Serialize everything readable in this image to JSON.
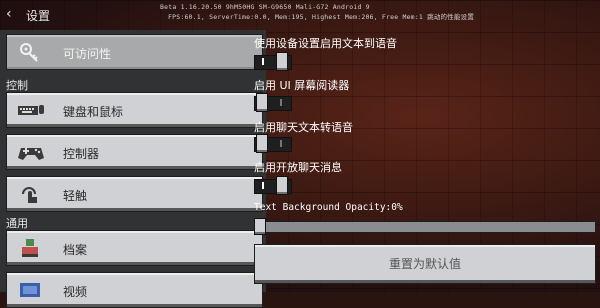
{
  "header": {
    "back_icon": "chevron-left-icon",
    "title": "设置",
    "debug_line1": "Beta 1.16.20.50 9hM50HG SM-G9650 Mali-G72 Android 9",
    "debug_line2": "FPS:60.1, ServerTime:0.0, Mem:195, Highest Mem:206, Free Mem:1 跳动的性能",
    "debug_line2_tail": "设置"
  },
  "sidebar": {
    "items": [
      {
        "label": "可访问性",
        "icon": "key-icon",
        "active": true
      },
      {
        "label": "键盘和鼠标",
        "icon": "keyboard-icon"
      },
      {
        "label": "控制器",
        "icon": "gamepad-icon"
      },
      {
        "label": "轻触",
        "icon": "touch-icon"
      },
      {
        "label": "档案",
        "icon": "profile-icon"
      },
      {
        "label": "视频",
        "icon": "video-icon"
      }
    ],
    "section_control": "控制",
    "section_general": "通用"
  },
  "settings": [
    {
      "label": "使用设备设置启用文本到语音",
      "state": "on"
    },
    {
      "label": "启用 UI 屏幕阅读器",
      "state": "off"
    },
    {
      "label": "启用聊天文本转语音",
      "state": "off"
    },
    {
      "label": "启用开放聊天消息",
      "state": "on"
    }
  ],
  "opacity": {
    "label": "Text Background Opacity:0%",
    "value": 0
  },
  "reset_label": "重置为默认值",
  "colors": {
    "panel": "#313233",
    "button": "#d0d1d4",
    "button_active": "#a8a9ab"
  }
}
